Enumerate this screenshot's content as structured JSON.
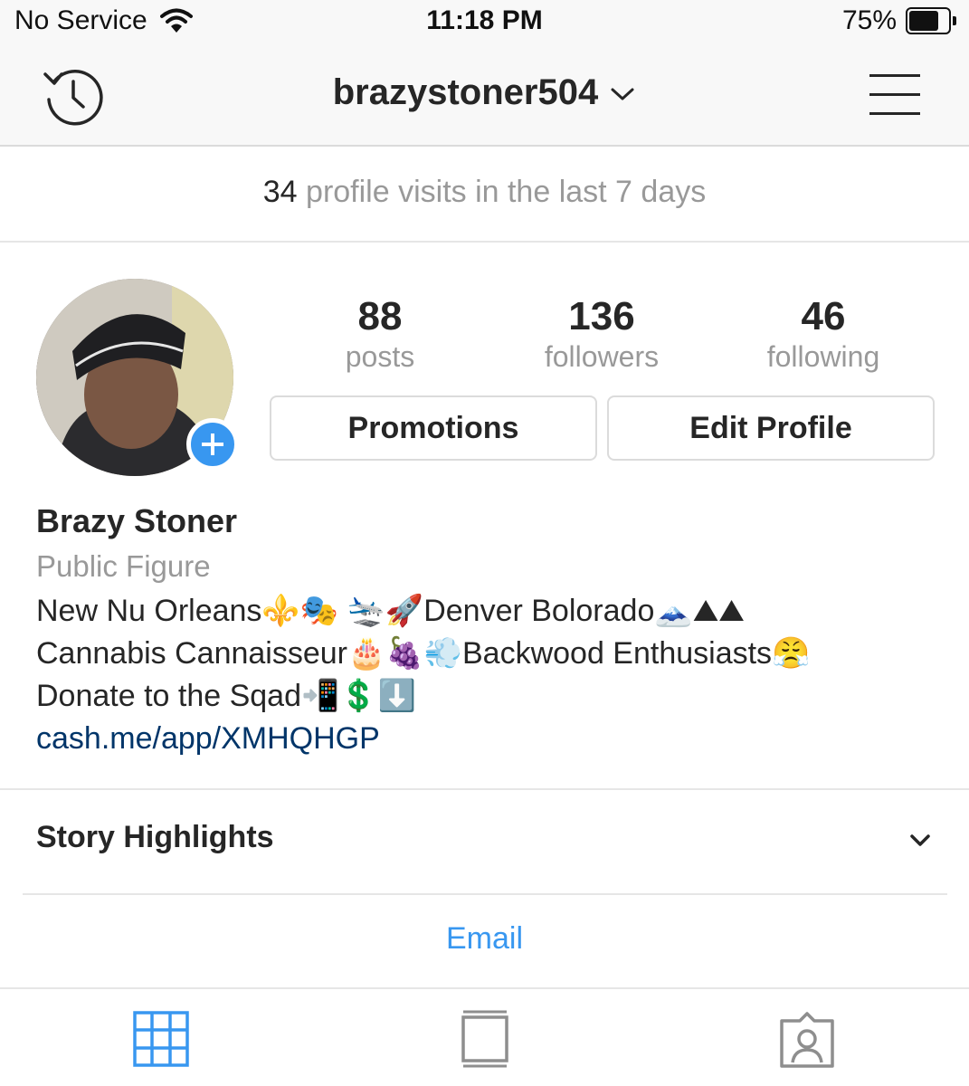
{
  "status_bar": {
    "carrier": "No Service",
    "time": "11:18 PM",
    "battery_percent": "75%",
    "battery_level": 0.75
  },
  "nav": {
    "username": "brazystoner504",
    "history_icon": "history-icon",
    "menu_icon": "hamburger-menu-icon"
  },
  "insights": {
    "visits_count": "34",
    "visits_text": "profile visits in the last 7 days"
  },
  "stats": [
    {
      "value": "88",
      "label": "posts"
    },
    {
      "value": "136",
      "label": "followers"
    },
    {
      "value": "46",
      "label": "following"
    }
  ],
  "buttons": {
    "promotions": "Promotions",
    "edit_profile": "Edit Profile"
  },
  "bio": {
    "name": "Brazy Stoner",
    "category": "Public Figure",
    "lines": [
      "New Nu Orleans⚜️🎭 🛬🚀Denver Bolorado🗻⛰⛰",
      "Cannabis Cannaisseur🎂🍇💨Backwood Enthusiasts😤",
      "Donate to the Sqad📲💲⬇️"
    ],
    "link": "cash.me/app/XMHQHGP"
  },
  "highlights": {
    "title": "Story Highlights"
  },
  "contact": {
    "email": "Email"
  },
  "colors": {
    "accent": "#3897f0",
    "link": "#003569",
    "muted": "#999999",
    "text": "#262626"
  },
  "tabs": [
    {
      "icon": "grid-icon",
      "active": true
    },
    {
      "icon": "feed-view-icon",
      "active": false
    },
    {
      "icon": "tagged-photos-icon",
      "active": false
    }
  ]
}
